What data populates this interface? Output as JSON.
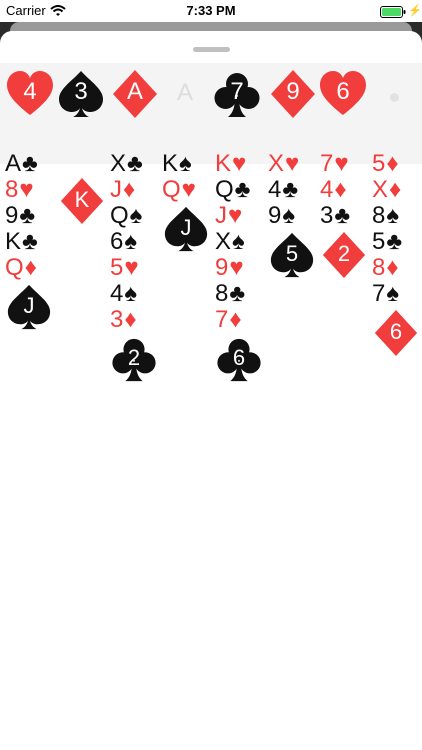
{
  "status_bar": {
    "carrier": "Carrier",
    "time": "7:33 PM"
  },
  "foundation": [
    {
      "rank": "4",
      "suit": "heart",
      "color": "red"
    },
    {
      "rank": "3",
      "suit": "spade",
      "color": "black"
    },
    {
      "rank": "A",
      "suit": "diamond",
      "color": "red"
    },
    {
      "rank": "A",
      "suit": "empty",
      "color": "light"
    },
    {
      "rank": "7",
      "suit": "club",
      "color": "black"
    },
    {
      "rank": "9",
      "suit": "diamond",
      "color": "red"
    },
    {
      "rank": "6",
      "suit": "heart",
      "color": "red"
    }
  ],
  "tableau": [
    {
      "rows": [
        {
          "rank": "A",
          "suit": "♣",
          "color": "black"
        },
        {
          "rank": "8",
          "suit": "♥",
          "color": "red"
        },
        {
          "rank": "9",
          "suit": "♣",
          "color": "black"
        },
        {
          "rank": "K",
          "suit": "♣",
          "color": "black"
        },
        {
          "rank": "Q",
          "suit": "♦",
          "color": "red"
        }
      ],
      "top": {
        "rank": "J",
        "suit": "spade",
        "color": "black"
      }
    },
    {
      "rows": [],
      "top": {
        "rank": "K",
        "suit": "diamond",
        "color": "red"
      }
    },
    {
      "rows": [
        {
          "rank": "X",
          "suit": "♣",
          "color": "black"
        },
        {
          "rank": "J",
          "suit": "♦",
          "color": "red"
        },
        {
          "rank": "Q",
          "suit": "♠",
          "color": "black"
        },
        {
          "rank": "6",
          "suit": "♠",
          "color": "black"
        },
        {
          "rank": "5",
          "suit": "♥",
          "color": "red"
        },
        {
          "rank": "4",
          "suit": "♠",
          "color": "black"
        },
        {
          "rank": "3",
          "suit": "♦",
          "color": "red"
        }
      ],
      "top": {
        "rank": "2",
        "suit": "club",
        "color": "black"
      }
    },
    {
      "rows": [
        {
          "rank": "K",
          "suit": "♠",
          "color": "black"
        },
        {
          "rank": "Q",
          "suit": "♥",
          "color": "red"
        }
      ],
      "top": {
        "rank": "J",
        "suit": "spade",
        "color": "black"
      }
    },
    {
      "rows": [
        {
          "rank": "K",
          "suit": "♥",
          "color": "red"
        },
        {
          "rank": "Q",
          "suit": "♣",
          "color": "black"
        },
        {
          "rank": "J",
          "suit": "♥",
          "color": "red"
        },
        {
          "rank": "X",
          "suit": "♠",
          "color": "black"
        },
        {
          "rank": "9",
          "suit": "♥",
          "color": "red"
        },
        {
          "rank": "8",
          "suit": "♣",
          "color": "black"
        },
        {
          "rank": "7",
          "suit": "♦",
          "color": "red"
        }
      ],
      "top": {
        "rank": "6",
        "suit": "club",
        "color": "black"
      }
    },
    {
      "rows": [
        {
          "rank": "X",
          "suit": "♥",
          "color": "red"
        },
        {
          "rank": "4",
          "suit": "♣",
          "color": "black"
        },
        {
          "rank": "9",
          "suit": "♠",
          "color": "black"
        }
      ],
      "top": {
        "rank": "5",
        "suit": "spade",
        "color": "black"
      }
    },
    {
      "rows": [
        {
          "rank": "7",
          "suit": "♥",
          "color": "red"
        },
        {
          "rank": "4",
          "suit": "♦",
          "color": "red"
        },
        {
          "rank": "3",
          "suit": "♣",
          "color": "black"
        }
      ],
      "top": {
        "rank": "2",
        "suit": "diamond",
        "color": "red"
      }
    },
    {
      "rows": [
        {
          "rank": "5",
          "suit": "♦",
          "color": "red"
        },
        {
          "rank": "X",
          "suit": "♦",
          "color": "red"
        },
        {
          "rank": "8",
          "suit": "♠",
          "color": "black"
        },
        {
          "rank": "5",
          "suit": "♣",
          "color": "black"
        },
        {
          "rank": "8",
          "suit": "♦",
          "color": "red"
        },
        {
          "rank": "7",
          "suit": "♠",
          "color": "black"
        }
      ],
      "top": {
        "rank": "6",
        "suit": "diamond",
        "color": "red"
      }
    }
  ],
  "colors": {
    "red": "#f23d3d",
    "black": "#111111",
    "light": "#dddddd"
  }
}
